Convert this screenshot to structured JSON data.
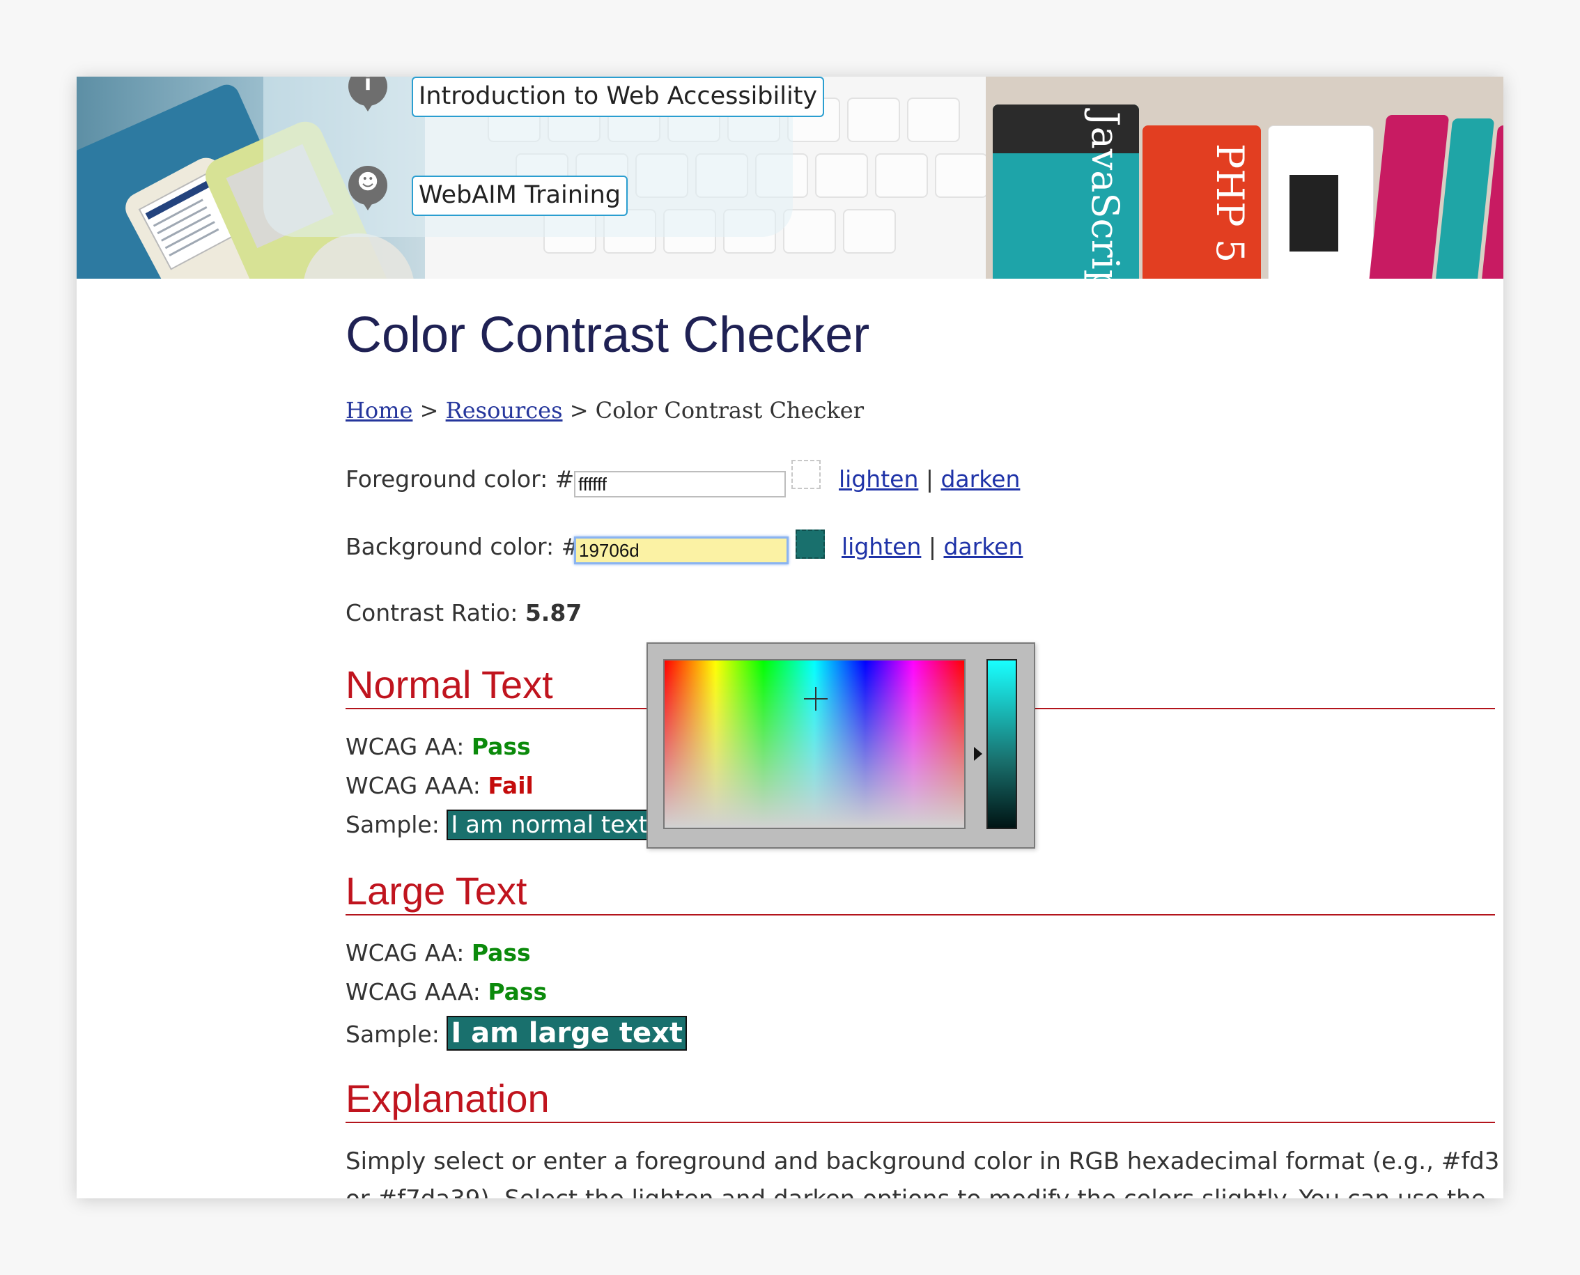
{
  "banner": {
    "nav": [
      {
        "label": "Introduction to Web Accessibility",
        "icon": "info-icon"
      },
      {
        "label": "WebAIM Training",
        "icon": "people-icon"
      }
    ],
    "book_spines": [
      "JavaScript",
      "PHP 5"
    ]
  },
  "page": {
    "title": "Color Contrast Checker",
    "breadcrumb": {
      "home": "Home",
      "resources": "Resources",
      "separator": ">",
      "current": "Color Contrast Checker"
    }
  },
  "foreground": {
    "label": "Foreground color: #",
    "value": "ffffff",
    "lighten": "lighten",
    "darken": "darken",
    "separator": "|"
  },
  "background": {
    "label": "Background color: #",
    "value": "19706d",
    "lighten": "lighten",
    "darken": "darken",
    "separator": "|"
  },
  "contrast": {
    "label": "Contrast Ratio: ",
    "value": "5.87"
  },
  "normal_text": {
    "heading": "Normal Text",
    "aa_label": "WCAG AA: ",
    "aa_result": "Pass",
    "aaa_label": "WCAG AAA: ",
    "aaa_result": "Fail",
    "sample_label": "Sample: ",
    "sample_text": "I am normal text"
  },
  "large_text": {
    "heading": "Large Text",
    "aa_label": "WCAG AA: ",
    "aa_result": "Pass",
    "aaa_label": "WCAG AAA: ",
    "aaa_result": "Pass",
    "sample_label": "Sample: ",
    "sample_text": "I am large text"
  },
  "explanation": {
    "heading": "Explanation",
    "text": "Simply select or enter a foreground and background color in RGB hexadecimal format (e.g., #fd3 or #f7da39). Select the lighten and darken options to modify the colors slightly. You can use the color"
  },
  "colors": {
    "title": "#1f2154",
    "link": "#1f33a8",
    "section_heading": "#c0141e",
    "pass": "#0b8a0b",
    "fail": "#c40b0b",
    "sample_background": "#19706d",
    "sample_foreground": "#ffffff"
  }
}
